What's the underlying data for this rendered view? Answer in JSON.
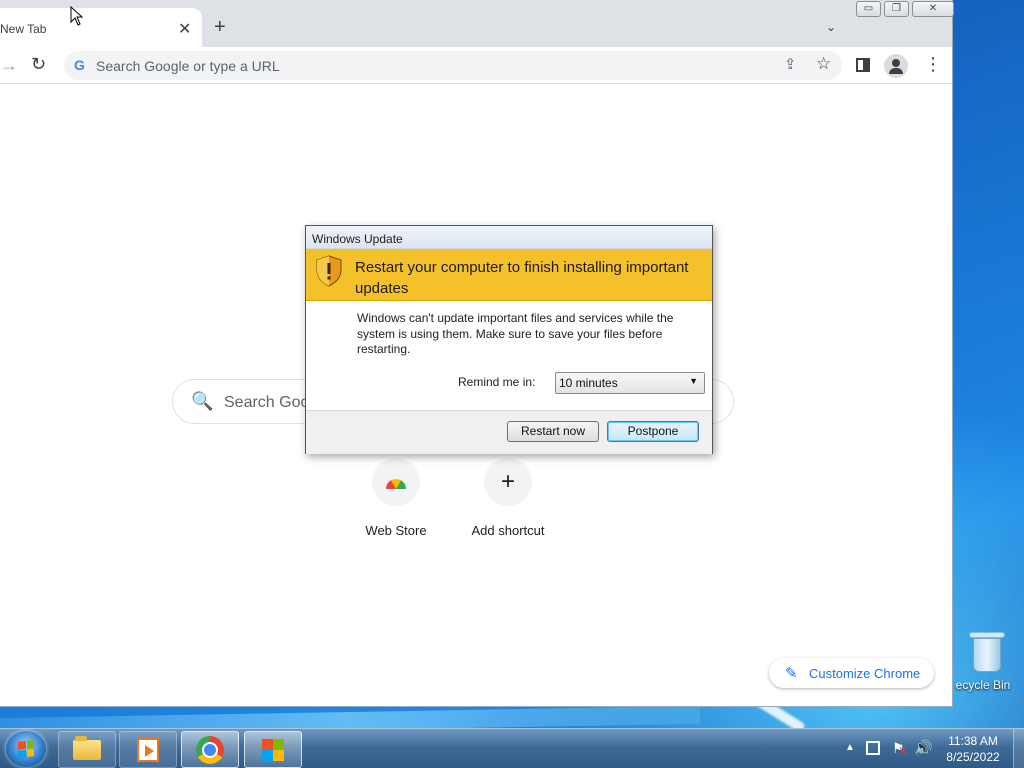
{
  "desktop": {
    "recycle_bin_label": "ecycle Bin"
  },
  "browser": {
    "tab_title": "New Tab",
    "tab_close": "✕",
    "new_tab": "+",
    "tab_search": "⌄",
    "window_controls": {
      "minimize": "▭",
      "restore": "❐",
      "close": "✕"
    },
    "forward_glyph": "→",
    "reload_glyph": "↻",
    "omnibox_g": "G",
    "omnibox_placeholder": "Search Google or type a URL",
    "menu_glyph": "⋮",
    "share_glyph": "⇪",
    "star_glyph": "☆",
    "search_box_placeholder": "Search Goo",
    "search_glyph": "🔍",
    "shortcuts": [
      {
        "label": "Web Store",
        "icon": "webstore-icon"
      },
      {
        "label": "Add shortcut",
        "glyph": "+",
        "icon": "plus-icon"
      }
    ],
    "customize_label": "Customize Chrome",
    "customize_glyph": "✎"
  },
  "dialog": {
    "title": "Windows Update",
    "headline": "Restart your computer to finish installing important updates",
    "message": "Windows can't update important files and services while the system is using them. Make sure to save your files before restarting.",
    "remind_label": "Remind me in:",
    "remind_value": "10 minutes",
    "select_arrow": "▼",
    "restart_button": "Restart now",
    "postpone_button": "Postpone"
  },
  "taskbar": {
    "tray_arrow": "▲",
    "tray_flag_glyph": "⚑",
    "tray_flag_x": "✕",
    "tray_volume_glyph": "🔊",
    "time": "11:38 AM",
    "date": "8/25/2022"
  },
  "colors": {
    "dialog_banner": "#f5c12a",
    "chrome_blue": "#1a73e8",
    "taskbar": "#3f6b98"
  }
}
